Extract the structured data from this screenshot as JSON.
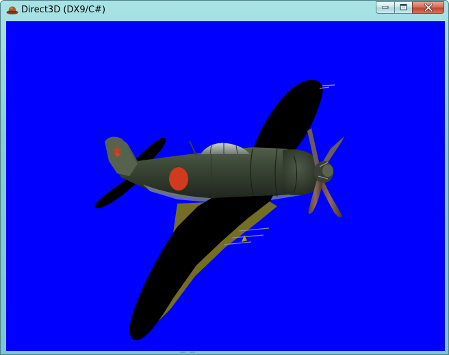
{
  "window": {
    "title": "Direct3D (DX9/C#)",
    "icon": "hat-icon",
    "controls": [
      "minimize-icon",
      "maximize-icon",
      "close-icon"
    ]
  },
  "viewport": {
    "background": "#0000FF",
    "content": "aircraft-model"
  },
  "colors": {
    "frame": "#86CDD3",
    "aircraft_body": "#3A4634",
    "hinomaru": "#D03A1E",
    "wing_shadow": "#000000"
  }
}
